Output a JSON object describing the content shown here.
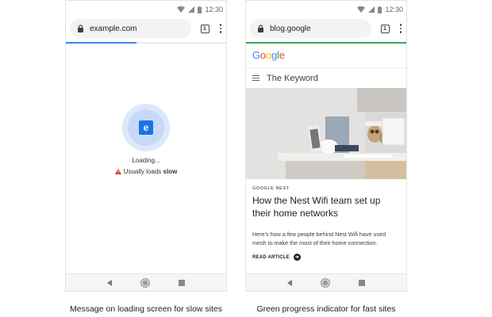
{
  "status_time": "12:30",
  "left_phone": {
    "url": "example.com",
    "tab_count": "1",
    "favicon_letter": "e",
    "loading_text": "Loading...",
    "slow_prefix": "Usually loads ",
    "slow_word": "slow",
    "progress": 0.44,
    "progress_color": "#4285f4"
  },
  "right_phone": {
    "url": "blog.google",
    "tab_count": "1",
    "progress": 1.0,
    "progress_color": "#34a853",
    "site_logo": "Google",
    "section_title": "The Keyword",
    "eyebrow": "GOOGLE NEST",
    "headline": "How the Nest Wifi team set up their home networks",
    "summary": "Here’s how a few people behind Nest Wifi have used mesh to make the most of their home connection.",
    "cta": "READ ARTICLE"
  },
  "captions": {
    "left": "Message on loading screen for slow sites",
    "right": "Green progress indicator for fast sites"
  },
  "icons": [
    "wifi-icon",
    "signal-icon",
    "battery-icon",
    "lock-icon",
    "tabs-icon",
    "more-menu-icon",
    "warning-icon",
    "menu-icon",
    "arrow-right-icon",
    "back-icon",
    "home-icon",
    "recents-icon"
  ]
}
